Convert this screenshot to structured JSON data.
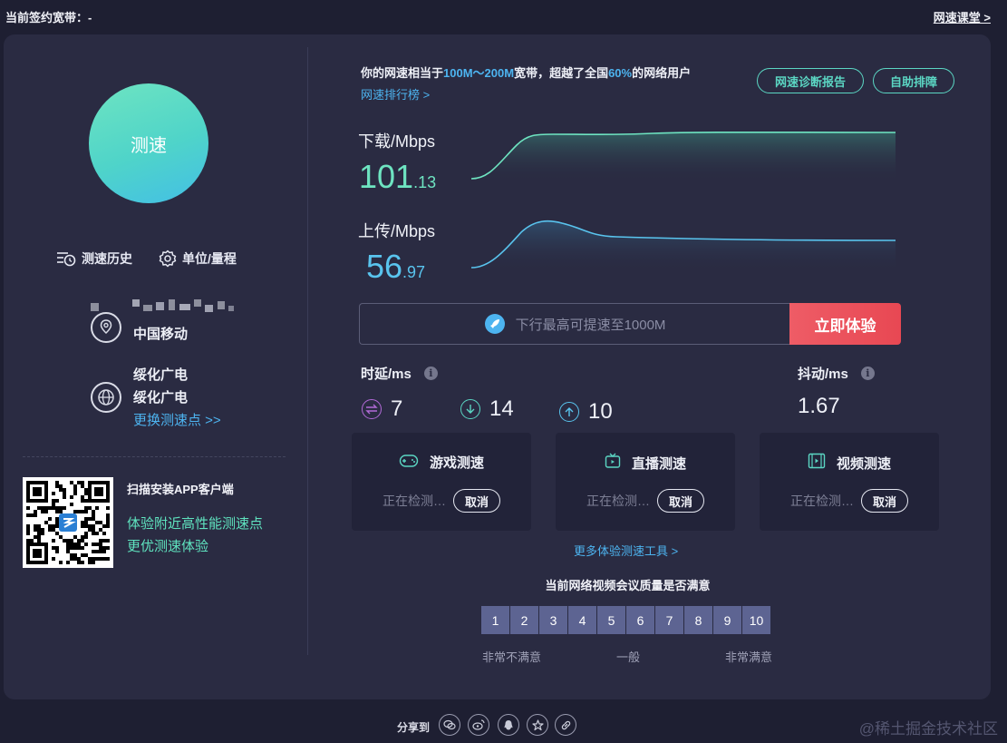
{
  "topbar": {
    "contract_bandwidth": "当前签约宽带：-",
    "classroom_link": "网速课堂 >"
  },
  "left": {
    "speed_button": "测速",
    "history_label": "测速历史",
    "unit_label": "单位/量程",
    "isp": "中国移动",
    "server_line1": "绥化广电",
    "server_line2": "绥化广电",
    "change_server": "更换测速点 >>",
    "qr_title": "扫描安装APP客户端",
    "qr_line1": "体验附近高性能测速点",
    "qr_line2": "更优测速体验"
  },
  "summary": {
    "prefix": "你的网速相当于",
    "bandwidth": "100M～200M",
    "middle": "宽带，超越了全国",
    "percent": "60%",
    "suffix": "的网络用户",
    "rank_link": "网速排行榜 >"
  },
  "buttons": {
    "diagnosis": "网速诊断报告",
    "troubleshoot": "自助排障"
  },
  "download": {
    "label": "下载/Mbps",
    "int": "101",
    "dec": ".13"
  },
  "upload": {
    "label": "上传/Mbps",
    "int": "56",
    "dec": ".97"
  },
  "promo": {
    "text": "下行最高可提速至1000M",
    "cta": "立即体验"
  },
  "latency": {
    "label": "时延/ms",
    "values": [
      "7",
      "14",
      "10"
    ]
  },
  "jitter": {
    "label": "抖动/ms",
    "value": "1.67"
  },
  "tests": [
    {
      "title": "游戏测速",
      "status": "正在检测…",
      "cancel": "取消"
    },
    {
      "title": "直播测速",
      "status": "正在检测…",
      "cancel": "取消"
    },
    {
      "title": "视频测速",
      "status": "正在检测…",
      "cancel": "取消"
    }
  ],
  "more_tools": "更多体验测速工具 >",
  "survey": {
    "title": "当前网络视频会议质量是否满意",
    "ratings": [
      "1",
      "2",
      "3",
      "4",
      "5",
      "6",
      "7",
      "8",
      "9",
      "10"
    ],
    "low": "非常不满意",
    "mid": "一般",
    "high": "非常满意"
  },
  "share_label": "分享到",
  "share_icons": [
    "wechat-icon",
    "weibo-icon",
    "qq-icon",
    "qzone-icon",
    "link-icon"
  ],
  "watermark": "@稀土掘金技术社区",
  "colors": {
    "accent_green": "#6ee4c1",
    "accent_blue": "#4db4f0",
    "cta_red": "#e84853"
  }
}
